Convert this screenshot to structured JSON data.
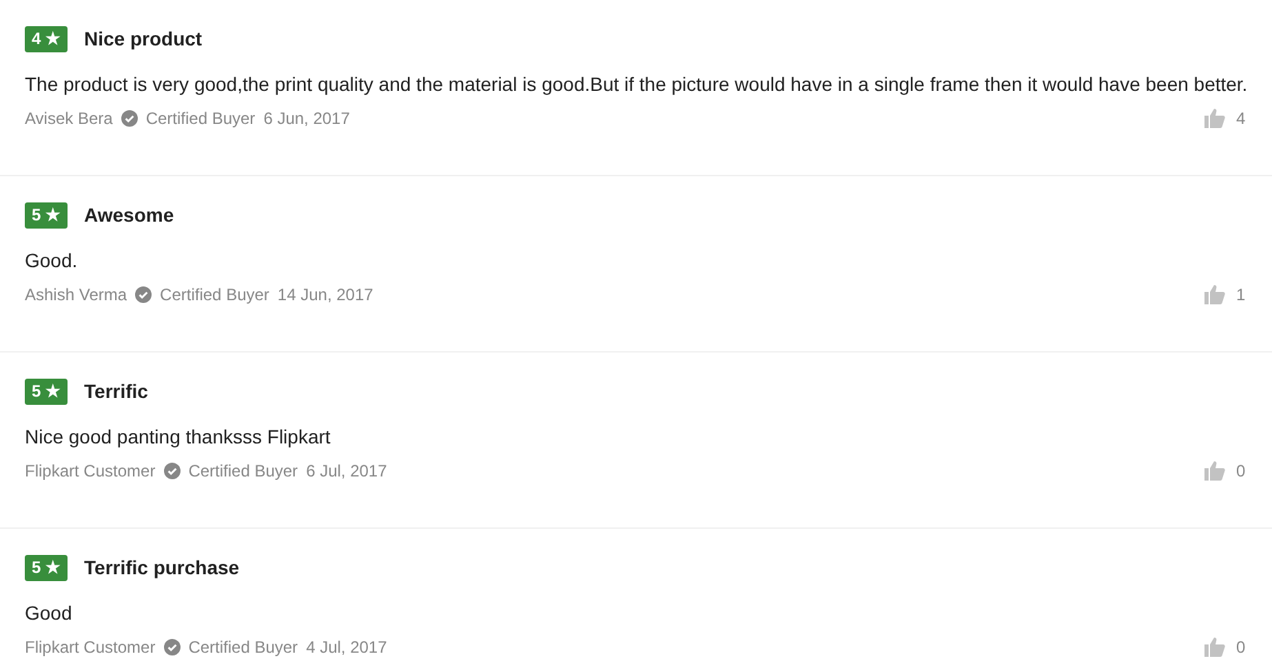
{
  "reviews": [
    {
      "rating": "4 ★",
      "title": "Nice product",
      "body": "The product is very good,the print quality and the material is good.But if the picture would have in a single frame then it would have been better.",
      "author": "Avisek Bera",
      "badge": "Certified Buyer",
      "date": "6 Jun, 2017",
      "likes": "4"
    },
    {
      "rating": "5 ★",
      "title": "Awesome",
      "body": "Good.",
      "author": "Ashish Verma",
      "badge": "Certified Buyer",
      "date": "14 Jun, 2017",
      "likes": "1"
    },
    {
      "rating": "5 ★",
      "title": "Terrific",
      "body": "Nice good panting thanksss Flipkart",
      "author": "Flipkart Customer",
      "badge": "Certified Buyer",
      "date": "6 Jul, 2017",
      "likes": "0"
    },
    {
      "rating": "5 ★",
      "title": "Terrific purchase",
      "body": "Good",
      "author": "Flipkart Customer",
      "badge": "Certified Buyer",
      "date": "4 Jul, 2017",
      "likes": "0"
    }
  ]
}
